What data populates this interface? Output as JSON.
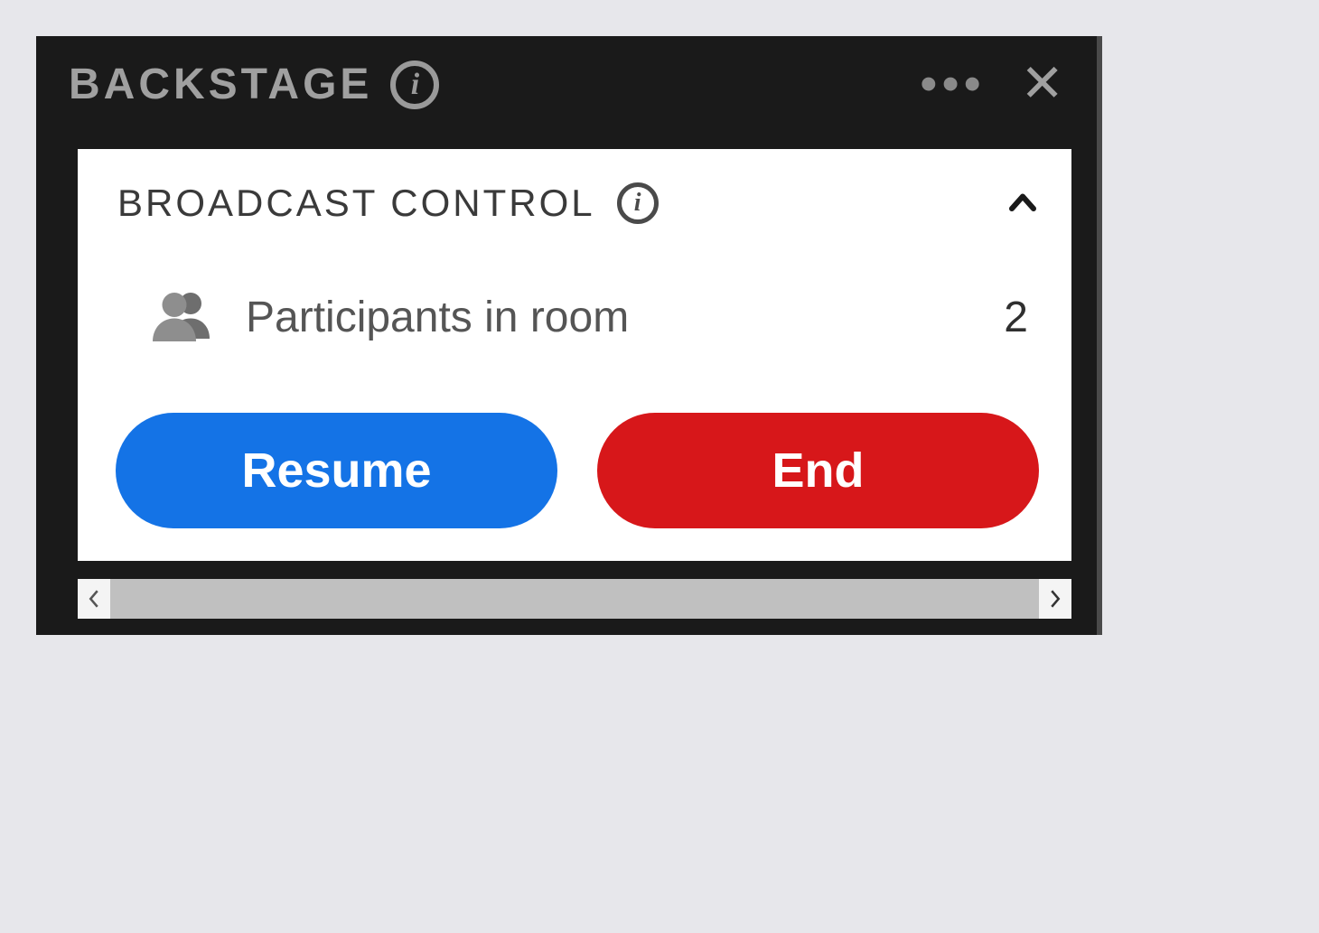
{
  "panel": {
    "title": "BACKSTAGE"
  },
  "card": {
    "title": "BROADCAST CONTROL",
    "participants_label": "Participants in room",
    "participants_count": "2",
    "buttons": {
      "resume": "Resume",
      "end": "End"
    }
  }
}
